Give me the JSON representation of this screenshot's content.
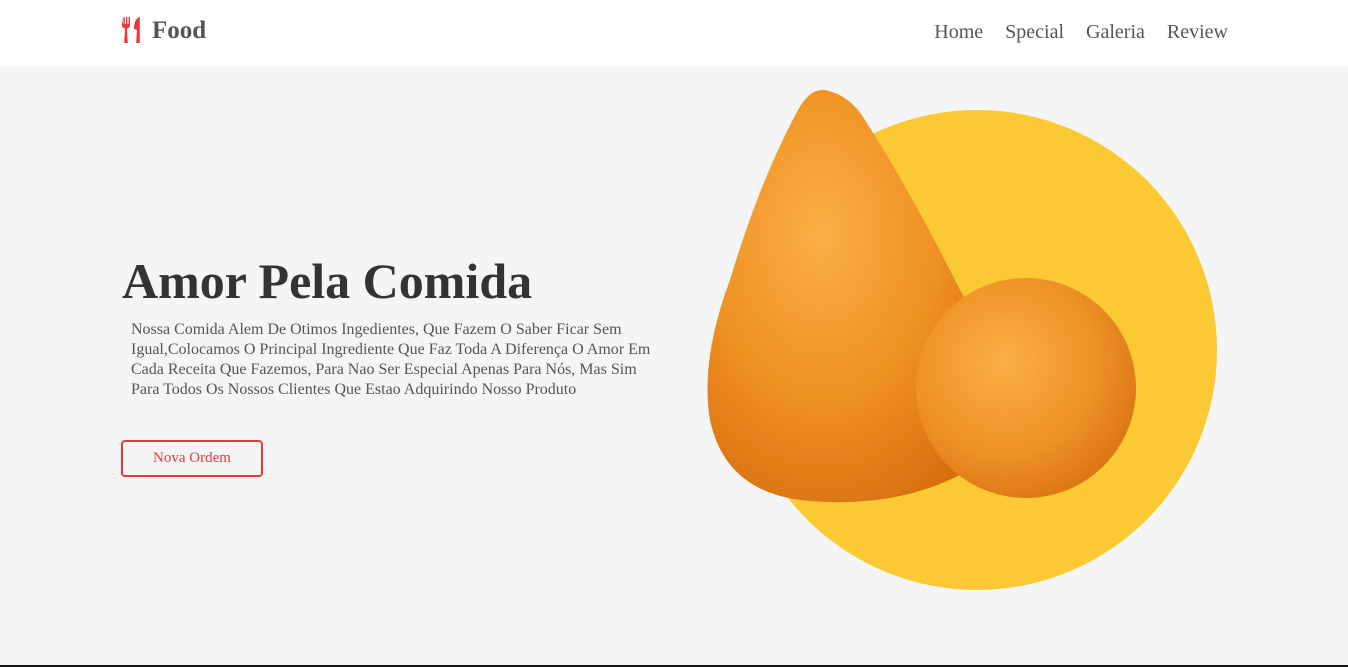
{
  "brand": {
    "name": "Food",
    "icon": "fork-knife-icon",
    "accent_color": "#e53a3a"
  },
  "nav": {
    "items": [
      "Home",
      "Special",
      "Galeria",
      "Review"
    ]
  },
  "hero": {
    "title": "Amor Pela Comida",
    "description": "Nossa Comida Alem De Otimos Ingedientes, Que Fazem O Saber Ficar Sem Igual,Colocamos O Principal Ingrediente Que Faz Toda A Diferença O Amor Em Cada Receita Que Fazemos, Para Nao Ser Especial Apenas Para Nós, Mas Sim Para Todos Os Nossos Clientes Que Estao Adquirindo Nosso Produto",
    "cta_label": "Nova Ordem",
    "circle_color": "#fbc933",
    "food_color": "#f0901e"
  }
}
